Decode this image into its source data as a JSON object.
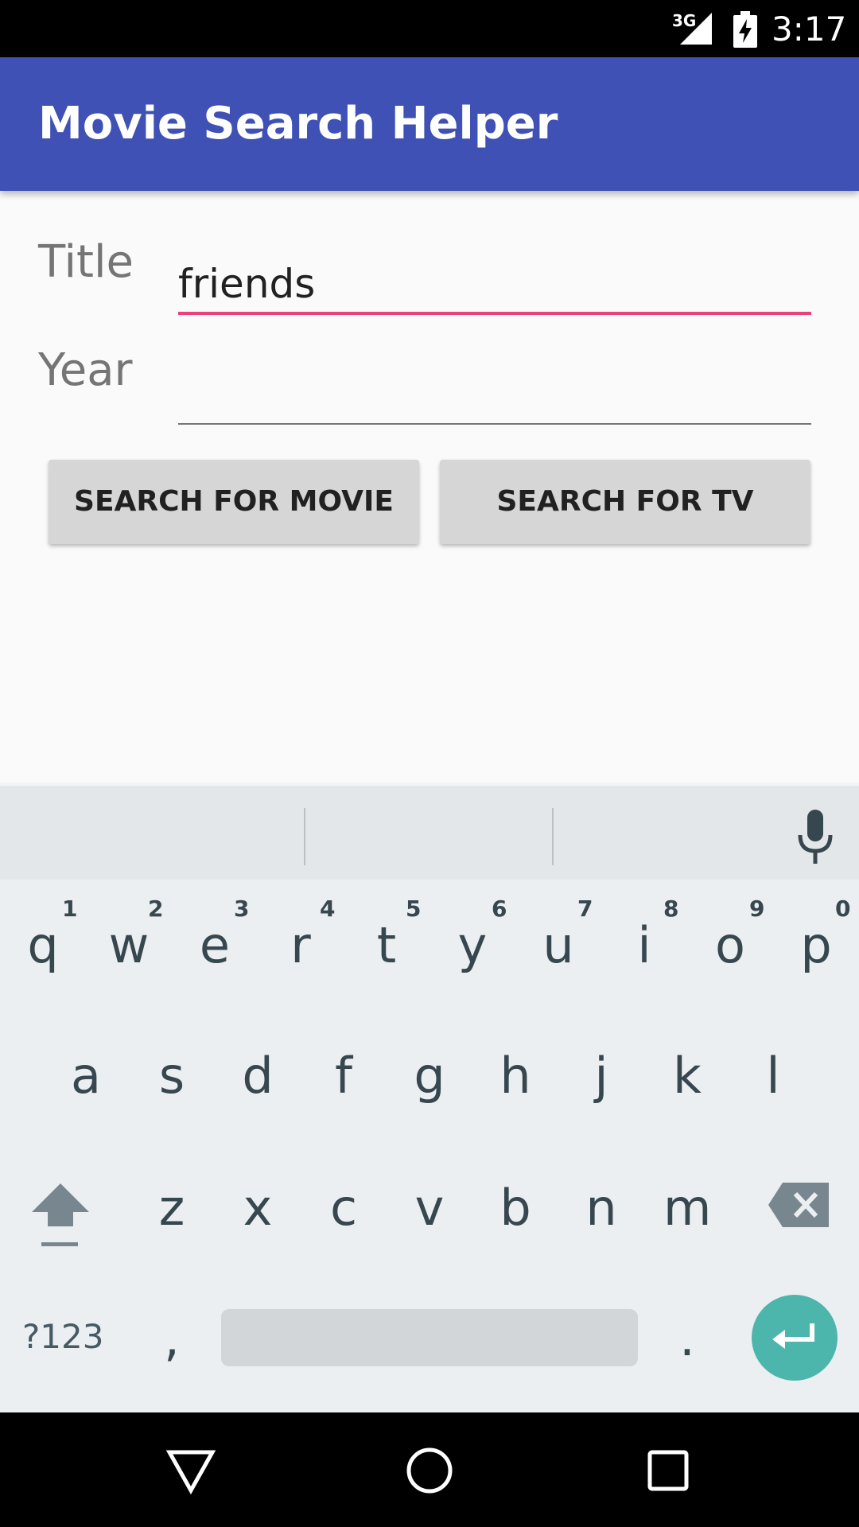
{
  "status_bar": {
    "network": "3G",
    "time": "3:17",
    "icons": [
      "signal-icon",
      "battery-charging-icon"
    ]
  },
  "app_bar": {
    "title": "Movie Search Helper"
  },
  "form": {
    "title_label": "Title",
    "title_value": "friends",
    "year_label": "Year",
    "year_value": ""
  },
  "buttons": {
    "search_movie": "SEARCH FOR MOVIE",
    "search_tv": "SEARCH FOR TV"
  },
  "keyboard": {
    "row1": [
      {
        "key": "q",
        "hint": "1"
      },
      {
        "key": "w",
        "hint": "2"
      },
      {
        "key": "e",
        "hint": "3"
      },
      {
        "key": "r",
        "hint": "4"
      },
      {
        "key": "t",
        "hint": "5"
      },
      {
        "key": "y",
        "hint": "6"
      },
      {
        "key": "u",
        "hint": "7"
      },
      {
        "key": "i",
        "hint": "8"
      },
      {
        "key": "o",
        "hint": "9"
      },
      {
        "key": "p",
        "hint": "0"
      }
    ],
    "row2": [
      "a",
      "s",
      "d",
      "f",
      "g",
      "h",
      "j",
      "k",
      "l"
    ],
    "row3": [
      "z",
      "x",
      "c",
      "v",
      "b",
      "n",
      "m"
    ],
    "symbols_label": "?123",
    "comma": ",",
    "period": ".",
    "accent_color": "#4db6ac"
  },
  "nav_bar": {
    "icons": [
      "back-icon",
      "home-icon",
      "recents-icon"
    ]
  }
}
